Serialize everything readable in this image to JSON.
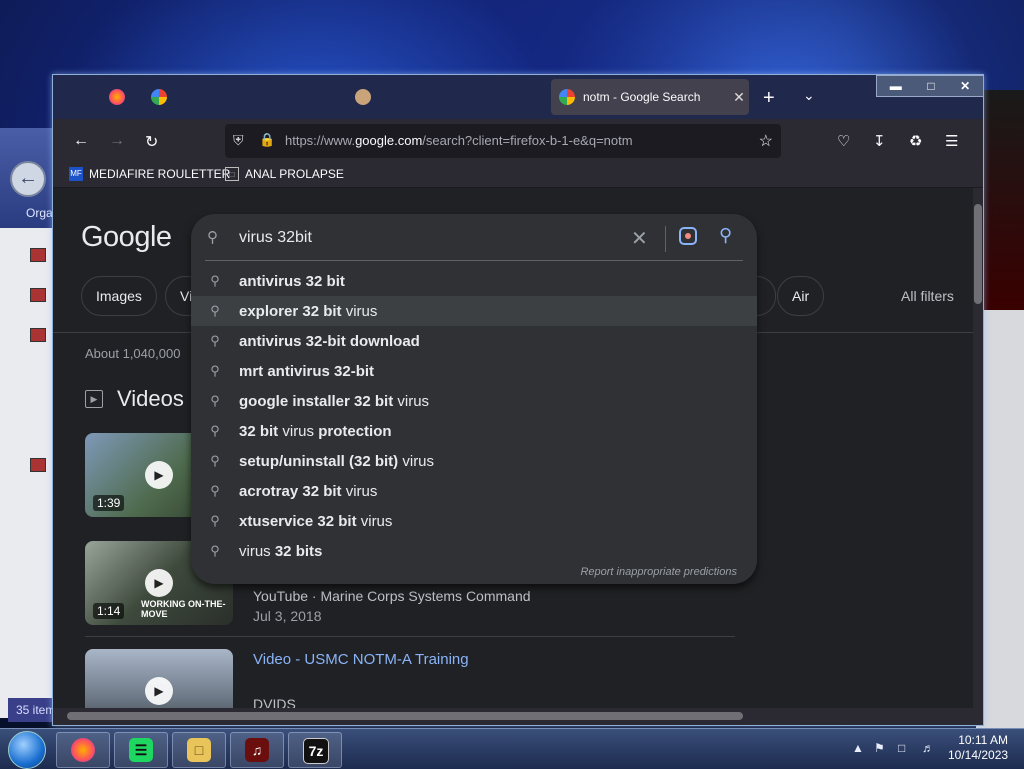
{
  "browser": {
    "active_tab_title": "notm - Google Search",
    "url_prefix": "https://www.",
    "url_domain": "google.com",
    "url_rest": "/search?client=firefox-b-1-e&q=notm",
    "bookmarks": [
      {
        "label": "MEDIAFIRE ROULETTER"
      },
      {
        "label": "ANAL PROLAPSE"
      }
    ]
  },
  "google": {
    "logo": "Google",
    "chips": [
      "Images",
      "Vi",
      "Air"
    ],
    "all_filters": "All filters",
    "about": "About 1,040,000",
    "videos_heading": "Videos"
  },
  "search": {
    "query": "virus 32bit",
    "suggestions": [
      {
        "bold": "antivirus 32 bit",
        "normal": ""
      },
      {
        "bold": "explorer 32 bit",
        "normal": " virus"
      },
      {
        "bold": "antivirus 32-bit download",
        "normal": ""
      },
      {
        "bold": "mrt antivirus 32-bit",
        "normal": ""
      },
      {
        "bold": "google installer 32 bit",
        "normal": " virus"
      },
      {
        "bold": "32 bit",
        "normal": " virus ",
        "bold2": "protection"
      },
      {
        "bold": "setup/uninstall (32 bit)",
        "normal": " virus"
      },
      {
        "bold": "acrotray 32 bit",
        "normal": " virus"
      },
      {
        "bold": "xtuservice 32 bit",
        "normal": " virus"
      },
      {
        "prefix": "virus ",
        "bold": "32 bits",
        "normal": ""
      }
    ],
    "report": "Report inappropriate predictions"
  },
  "videos": [
    {
      "duration": "1:39"
    },
    {
      "duration": "1:14",
      "overlay": "WORKING ON-THE-MOVE",
      "source": "YouTube",
      "channel": "Marine Corps Systems Command",
      "date": "Jul 3, 2018"
    },
    {
      "title": "Video - USMC NOTM-A Training",
      "source": "DVIDS"
    }
  ],
  "explorer": {
    "org_label": "Orga",
    "status": "35 item"
  },
  "taskbar": {
    "apps": [
      "firefox",
      "spotify",
      "explorer",
      "winamp",
      "7z"
    ],
    "seven_zip": "7z",
    "time": "10:11 AM",
    "date": "10/14/2023"
  },
  "colors": {
    "accent": "#8ab4f8",
    "bg": "#202124"
  }
}
